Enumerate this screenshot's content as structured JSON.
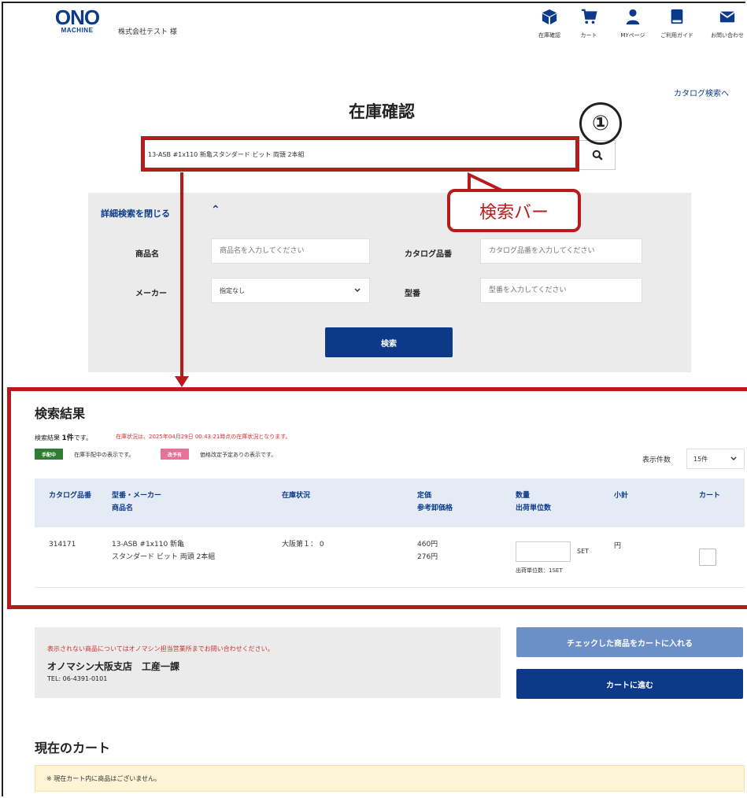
{
  "header": {
    "logo_top": "ONO",
    "logo_bottom": "MACHINE",
    "company": "株式会社テスト 様",
    "nav": [
      {
        "label": "在庫確認",
        "icon": "box-icon"
      },
      {
        "label": "カート",
        "icon": "cart-icon"
      },
      {
        "label": "MYページ",
        "icon": "user-icon"
      },
      {
        "label": "ご利用ガイド",
        "icon": "book-icon"
      },
      {
        "label": "お問い合わせ",
        "icon": "mail-icon"
      }
    ]
  },
  "catalog_link": "カタログ検索へ",
  "page_title": "在庫確認",
  "search": {
    "value": "13-ASB #1x110 新亀スタンダード ビット 両頭 2本組"
  },
  "annotation": {
    "number": "①",
    "callout": "検索バー"
  },
  "detail": {
    "toggle": "詳細検索を閉じる",
    "product_label": "商品名",
    "product_placeholder": "商品名を入力してください",
    "catalog_label": "カタログ品番",
    "catalog_placeholder": "カタログ品番を入力してください",
    "maker_label": "メーカー",
    "maker_value": "指定なし",
    "model_label": "型番",
    "model_placeholder": "型番を入力してください",
    "submit": "検索"
  },
  "results": {
    "title": "検索結果",
    "count_prefix": "検索結果 ",
    "count_num": "1件",
    "count_suffix": "です。",
    "note": "在庫状況は、2025年04月29日 00:43:21時点の在庫状況となります。",
    "badge1": "手配中",
    "badge1_text": "在庫手配中の表示です。",
    "badge2": "改予有",
    "badge2_text": "価格改定予定ありの表示です。",
    "per_page_label": "表示件数",
    "per_page_value": "15件",
    "headers": {
      "catalog": "カタログ品番",
      "model": "型番・メーカー",
      "product": "商品名",
      "stock": "在庫状況",
      "price": "定価",
      "ref_price": "参考卸価格",
      "qty": "数量",
      "unit": "出荷単位数",
      "subtotal": "小計",
      "cart": "カート"
    },
    "row": {
      "catalog": "314171",
      "model": "13-ASB #1x110 新亀",
      "product": "スタンダード ビット 両頭 2本組",
      "stock": "大阪第１： 0",
      "price": "460円",
      "ref_price": "276円",
      "qty_unit": "SET",
      "ship_unit": "出荷単位数：1SET",
      "subtotal": "円"
    }
  },
  "info": {
    "red": "表示されない商品についてはオノマシン担当営業所までお問い合わせください。",
    "branch": "オノマシン大阪支店　工産一課",
    "tel": "TEL: 06-4391-0101"
  },
  "buttons": {
    "add_checked": "チェックした商品をカートに入れる",
    "go_cart": "カートに進む"
  },
  "cart": {
    "title": "現在のカート",
    "empty": "※ 現在カート内に商品はございません。"
  }
}
